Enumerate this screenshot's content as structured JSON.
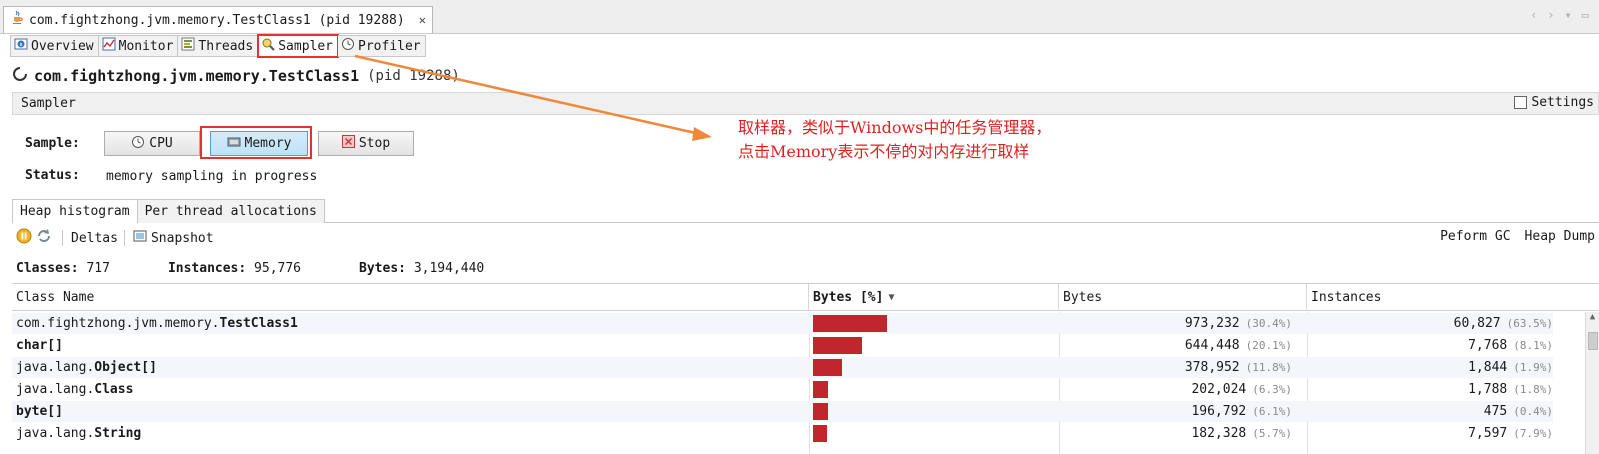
{
  "window": {
    "tab_title": "com.fightzhong.jvm.memory.TestClass1 (pid 19288)",
    "close_label": "✕",
    "ctrl_labels": [
      "‹",
      "›",
      "▾",
      "▭"
    ]
  },
  "subtabs": [
    {
      "label": "Overview",
      "icon": "info-icon"
    },
    {
      "label": "Monitor",
      "icon": "chart-icon"
    },
    {
      "label": "Threads",
      "icon": "threads-icon"
    },
    {
      "label": "Sampler",
      "icon": "sampler-icon",
      "active": true
    },
    {
      "label": "Profiler",
      "icon": "clock-icon"
    }
  ],
  "header": {
    "title": "com.fightzhong.jvm.memory.TestClass1",
    "pid": "(pid 19288)"
  },
  "sampler": {
    "bar_label": "Sampler",
    "settings_label": "Settings",
    "sample_label": "Sample:",
    "cpu_label": "CPU",
    "memory_label": "Memory",
    "stop_label": "Stop",
    "status_label": "Status:",
    "status_value": "memory sampling in progress"
  },
  "annotation": {
    "line1": "取样器，类似于Windows中的任务管理器，",
    "line2": "点击Memory表示不停的对内存进行取样",
    "color": "#e02020"
  },
  "inner_tabs": [
    "Heap histogram",
    "Per thread allocations"
  ],
  "toolbar": {
    "deltas_label": "Deltas",
    "snapshot_label": "Snapshot",
    "gc_label": "Peform GC",
    "heapdump_label": "Heap Dump"
  },
  "summary": {
    "classes_key": "Classes:",
    "classes_val": "717",
    "instances_key": "Instances:",
    "instances_val": "95,776",
    "bytes_key": "Bytes:",
    "bytes_val": "3,194,440"
  },
  "table": {
    "columns": [
      "Class Name",
      "Bytes [%]",
      "Bytes",
      "Instances"
    ],
    "sort_indicator": "▼",
    "rows": [
      {
        "prefix": "com.fightzhong.jvm.memory.",
        "name": "TestClass1",
        "pct_fraction": 0.304,
        "bytes": "973,232",
        "bytes_pct": "(30.4%)",
        "instances": "60,827",
        "inst_pct": "(63.5%)"
      },
      {
        "prefix": "",
        "name": "char[]",
        "pct_fraction": 0.201,
        "bytes": "644,448",
        "bytes_pct": "(20.1%)",
        "instances": "7,768",
        "inst_pct": "(8.1%)"
      },
      {
        "prefix": "java.lang.",
        "name": "Object[]",
        "pct_fraction": 0.118,
        "bytes": "378,952",
        "bytes_pct": "(11.8%)",
        "instances": "1,844",
        "inst_pct": "(1.9%)"
      },
      {
        "prefix": "java.lang.",
        "name": "Class",
        "pct_fraction": 0.063,
        "bytes": "202,024",
        "bytes_pct": "(6.3%)",
        "instances": "1,788",
        "inst_pct": "(1.8%)"
      },
      {
        "prefix": "",
        "name": "byte[]",
        "pct_fraction": 0.061,
        "bytes": "196,792",
        "bytes_pct": "(6.1%)",
        "instances": "475",
        "inst_pct": "(0.4%)"
      },
      {
        "prefix": "java.lang.",
        "name": "String",
        "pct_fraction": 0.057,
        "bytes": "182,328",
        "bytes_pct": "(5.7%)",
        "instances": "7,597",
        "inst_pct": "(7.9%)"
      }
    ]
  }
}
